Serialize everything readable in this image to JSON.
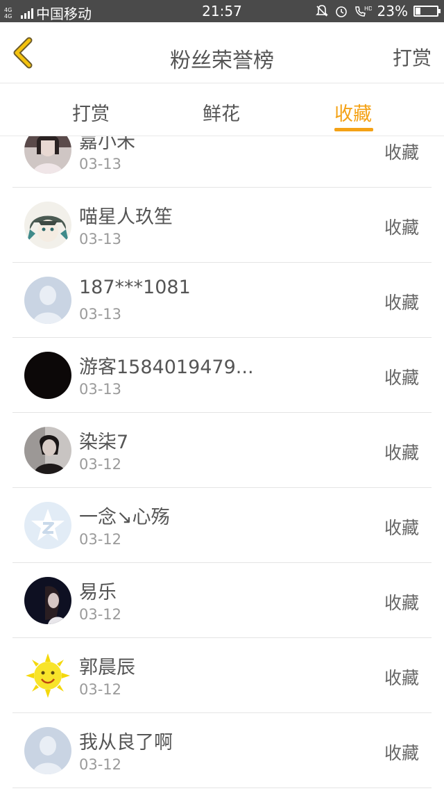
{
  "status_bar": {
    "network": "4G 4G",
    "carrier": "中国移动",
    "time": "21:57",
    "icons": [
      "notification-off-icon",
      "alarm-icon",
      "hd-call-icon"
    ],
    "battery_label": "23%",
    "battery_level": 0.23
  },
  "nav": {
    "back_icon": "chevron-left-icon",
    "title": "粉丝荣誉榜",
    "action_label": "打赏"
  },
  "tabs": [
    {
      "label": "打赏",
      "active": false
    },
    {
      "label": "鲜花",
      "active": false
    },
    {
      "label": "收藏",
      "active": true
    }
  ],
  "accent_color": "#f4a216",
  "rows": [
    {
      "name": "嘉小禾",
      "date": "03-13",
      "action": "收藏",
      "avatar": "girl-photo-avatar"
    },
    {
      "name": "喵星人玖笙",
      "date": "03-13",
      "action": "收藏",
      "avatar": "anime-avatar"
    },
    {
      "name": "187***1081",
      "date": "03-13",
      "action": "收藏",
      "avatar": "default-user-avatar"
    },
    {
      "name": "游客1584019479...",
      "date": "03-13",
      "action": "收藏",
      "avatar": "black-avatar"
    },
    {
      "name": "染柒7",
      "date": "03-12",
      "action": "收藏",
      "avatar": "person-photo-avatar"
    },
    {
      "name": "一念↘心殇",
      "date": "03-12",
      "action": "收藏",
      "avatar": "qzone-star-avatar"
    },
    {
      "name": "易乐",
      "date": "03-12",
      "action": "收藏",
      "avatar": "dark-portrait-avatar"
    },
    {
      "name": "郭晨辰",
      "date": "03-12",
      "action": "收藏",
      "avatar": "sun-cartoon-avatar"
    },
    {
      "name": "我从良了啊",
      "date": "03-12",
      "action": "收藏",
      "avatar": "default-user-avatar"
    }
  ]
}
